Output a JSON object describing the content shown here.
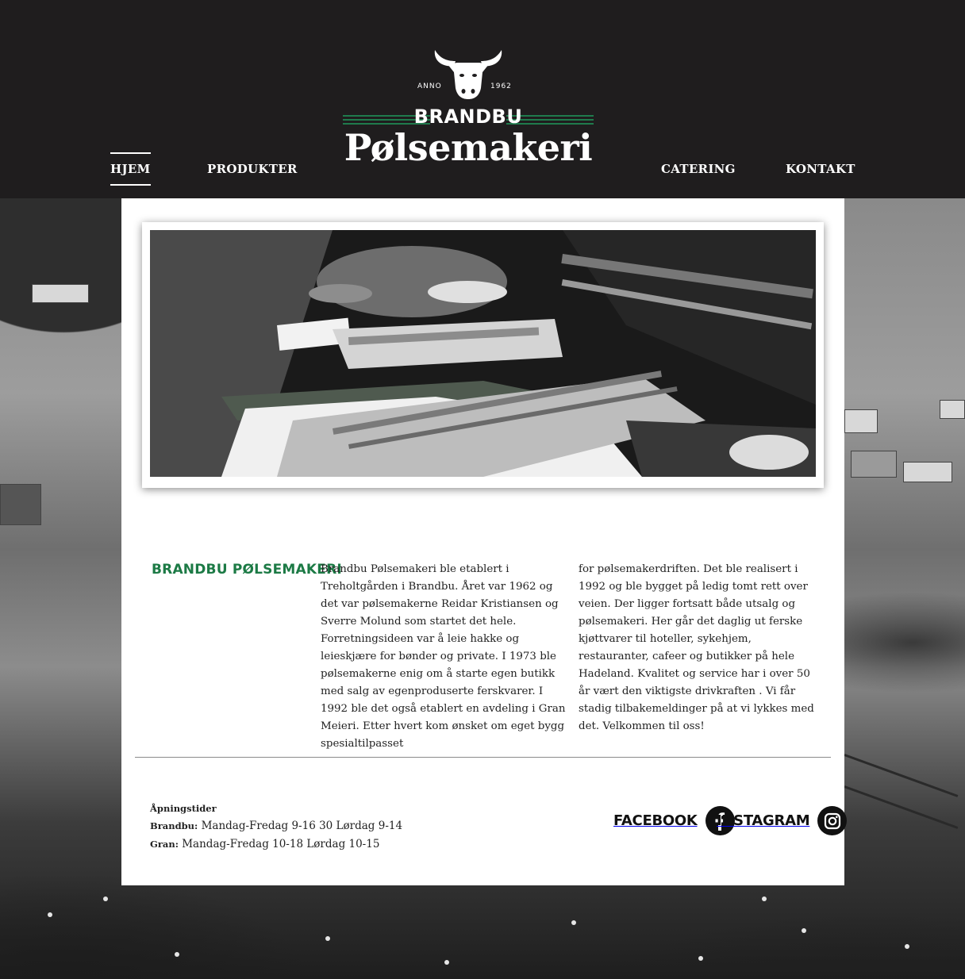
{
  "header": {
    "logo": {
      "anno": "ANNO",
      "year": "1962",
      "brand_top": "BRANDBU",
      "brand_script": "Pølsemakeri"
    },
    "nav": [
      {
        "label": "HJEM",
        "active": true
      },
      {
        "label": "PRODUKTER",
        "active": false
      },
      {
        "label": "CATERING",
        "active": false
      },
      {
        "label": "KONTAKT",
        "active": false
      }
    ]
  },
  "hero": {
    "image_icon": "meat-counter-photo"
  },
  "about": {
    "title": "BRANDBU PØLSEMAKERI",
    "col1": "Brandbu Pølsemakeri ble etablert i Treholtgården i Brandbu. Året var 1962 og det var pølsemakerne Reidar Kristiansen og Sverre Molund som startet det hele. Forretningsideen var å leie hakke og leieskjære for bønder og private. I 1973 ble pølsemakerne enig om å starte egen butikk med salg av egenproduserte ferskvarer. I 1992 ble det også etablert en avdeling i Gran Meieri. Etter hvert kom ønsket om eget bygg spesialtilpasset",
    "col2": "for pølsemakerdriften. Det ble realisert i 1992 og ble bygget på ledig tomt rett over veien. Der ligger fortsatt både utsalg og pølsemakeri. Her går det daglig ut ferske kjøttvarer til hoteller, sykehjem, restauranter, cafeer og butikker på hele Hadeland. Kvalitet og service har i over 50 år vært den viktigste drivkraften . Vi får stadig tilbakemeldinger på at vi lykkes med det. Velkommen til oss!"
  },
  "footer": {
    "hours_title": "Åpningstider",
    "rows": [
      {
        "place": "Brandbu:",
        "hours": "Mandag-Fredag 9-16 30 Lørdag 9-14"
      },
      {
        "place": "Gran:",
        "hours": "Mandag-Fredag 10-18 Lørdag 10-15"
      }
    ],
    "social": [
      {
        "label": "FACEBOOK",
        "icon": "facebook-icon"
      },
      {
        "label": "INSTAGRAM",
        "icon": "instagram-icon"
      }
    ]
  },
  "colors": {
    "header_bg": "#1f1d1e",
    "accent_green": "#1c7a45"
  }
}
